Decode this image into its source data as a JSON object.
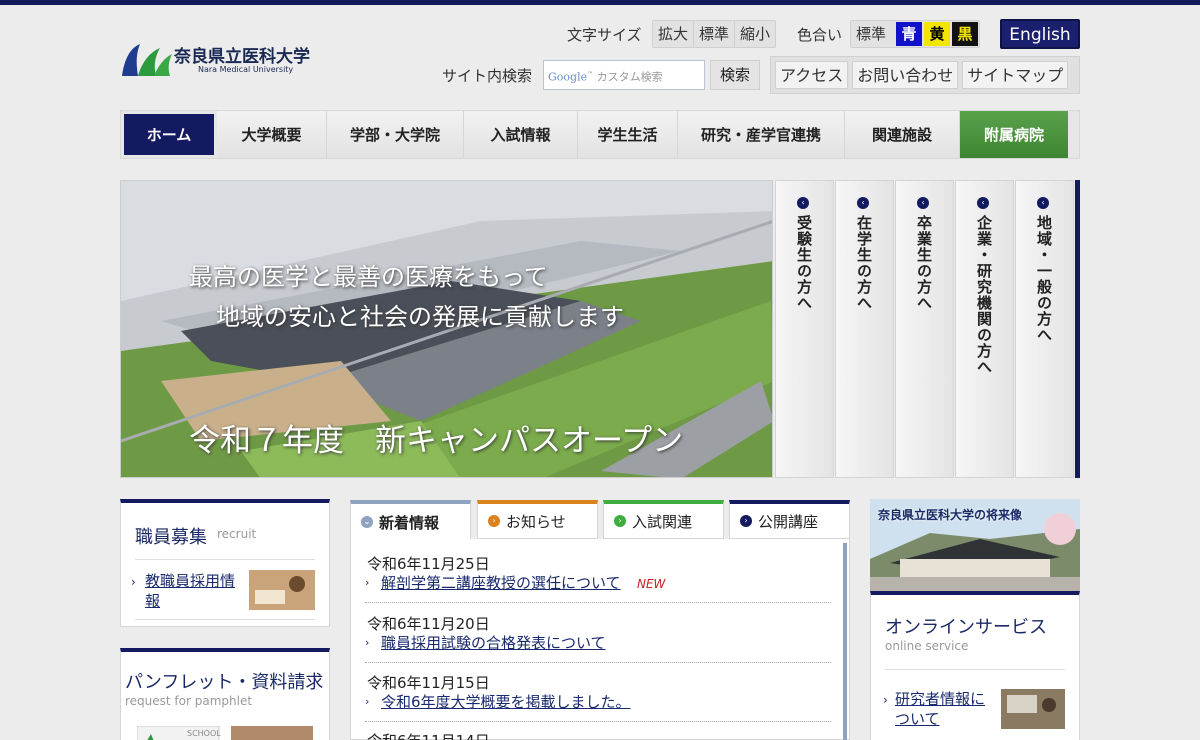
{
  "header": {
    "logo_ja": "奈良県立医科大学",
    "logo_en": "Nara Medical University",
    "font_size_label": "文字サイズ",
    "font_size_options": [
      "拡大",
      "標準",
      "縮小"
    ],
    "color_label": "色合い",
    "color_standard": "標準",
    "color_options": [
      {
        "label": "青",
        "bg": "#1111cc",
        "fg": "#ffffff"
      },
      {
        "label": "黄",
        "bg": "#f2e600",
        "fg": "#000000"
      },
      {
        "label": "黒",
        "bg": "#111111",
        "fg": "#f2e600"
      }
    ],
    "english": "English",
    "search_label": "サイト内検索",
    "search_google": "Google",
    "search_placeholder": "カスタム検索",
    "search_button": "検索",
    "links": [
      "アクセス",
      "お問い合わせ",
      "サイトマップ"
    ]
  },
  "nav": [
    "ホーム",
    "大学概要",
    "学部・大学院",
    "入試情報",
    "学生生活",
    "研究・産学官連携",
    "関連施設",
    "附属病院"
  ],
  "hero": {
    "line1": "最高の医学と最善の医療をもって",
    "line2": "地域の安心と社会の発展に貢献します",
    "line3": "令和７年度　新キャンパスオープン"
  },
  "audience_tabs": [
    "受験生の方へ",
    "在学生の方へ",
    "卒業生の方へ",
    "企業・研究機関の方へ",
    "地域・一般の方へ"
  ],
  "recruit": {
    "title": "職員募集",
    "subtitle": "recruit",
    "link": "教職員採用情報"
  },
  "pamphlet": {
    "title": "パンフレット・資料請求",
    "subtitle": "request for pamphlet",
    "thumb_text": "SCHOOL"
  },
  "news": {
    "tabs": [
      {
        "label": "新着情報",
        "color": "#8fa2c0"
      },
      {
        "label": "お知らせ",
        "color": "#d9821e"
      },
      {
        "label": "入試関連",
        "color": "#3fae3f"
      },
      {
        "label": "公開講座",
        "color": "#141a5f"
      }
    ],
    "items": [
      {
        "date": "令和6年11月25日",
        "title": "解剖学第二講座教授の選任について",
        "new": "NEW"
      },
      {
        "date": "令和6年11月20日",
        "title": "職員採用試験の合格発表について"
      },
      {
        "date": "令和6年11月15日",
        "title": "令和6年度大学概要を掲載しました。"
      },
      {
        "date": "令和6年11月14日",
        "title": ""
      }
    ]
  },
  "future_banner": "奈良県立医科大学の将来像",
  "online": {
    "title": "オンラインサービス",
    "subtitle": "online service",
    "link": "研究者情報について"
  }
}
